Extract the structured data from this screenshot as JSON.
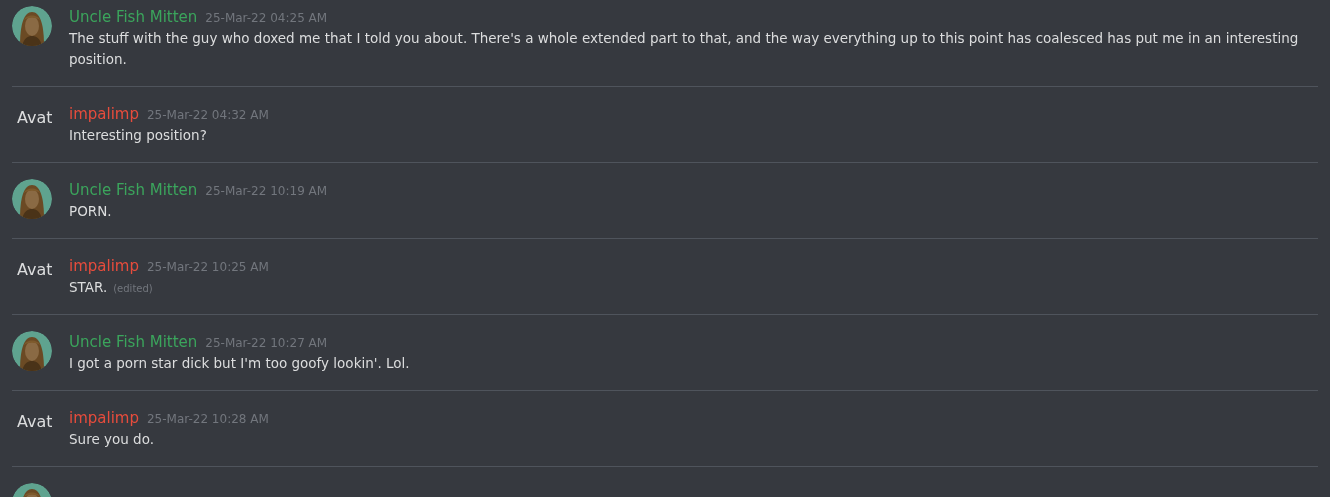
{
  "messages": [
    {
      "avatar": {
        "kind": "picture"
      },
      "author": "Uncle Fish Mitten",
      "color": "#3ba55c",
      "timestamp": "25-Mar-22 04:25 AM",
      "text": "The stuff with the guy who doxed me that I told you about. There's a whole extended part to that, and the way everything up to this point has coalesced has put me in an interesting position."
    },
    {
      "avatar": {
        "kind": "alt",
        "alt": "Avat"
      },
      "author": "impalimp",
      "color": "#e74c3c",
      "timestamp": "25-Mar-22 04:32 AM",
      "text": "Interesting position?"
    },
    {
      "avatar": {
        "kind": "picture"
      },
      "author": "Uncle Fish Mitten",
      "color": "#3ba55c",
      "timestamp": "25-Mar-22 10:19 AM",
      "text": "PORN."
    },
    {
      "avatar": {
        "kind": "alt",
        "alt": "Avat"
      },
      "author": "impalimp",
      "color": "#e74c3c",
      "timestamp": "25-Mar-22 10:25 AM",
      "text": "STAR.",
      "edited": "(edited)"
    },
    {
      "avatar": {
        "kind": "picture"
      },
      "author": "Uncle Fish Mitten",
      "color": "#3ba55c",
      "timestamp": "25-Mar-22 10:27 AM",
      "text": "I got a porn star dick but I'm too goofy lookin'. Lol."
    },
    {
      "avatar": {
        "kind": "alt",
        "alt": "Avat"
      },
      "author": "impalimp",
      "color": "#e74c3c",
      "timestamp": "25-Mar-22 10:28 AM",
      "text": "Sure you do."
    },
    {
      "avatar": {
        "kind": "picture"
      }
    }
  ]
}
